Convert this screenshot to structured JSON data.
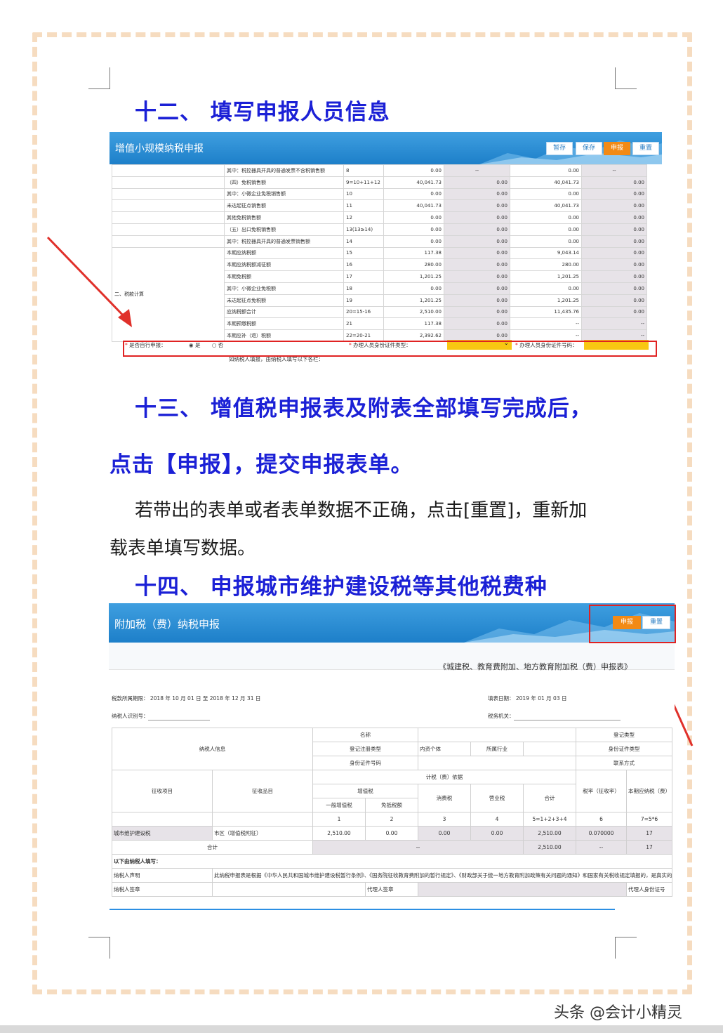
{
  "section12": {
    "heading": "十二、 填写申报人员信息"
  },
  "shot1": {
    "title": "增值小规模纳税申报",
    "buttons": [
      "暂存",
      "保存",
      "申报",
      "重置"
    ],
    "rows": [
      [
        "其中：税控器具开具的普通发票不含税销售额",
        "8",
        "0.00",
        "--",
        "0.00",
        "--"
      ],
      [
        "（四）免税销售额",
        "9=10+11+12",
        "40,041.73",
        "0.00",
        "40,041.73",
        "0.00"
      ],
      [
        "其中：小微企业免税销售额",
        "10",
        "0.00",
        "0.00",
        "0.00",
        "0.00"
      ],
      [
        "未达起征点销售额",
        "11",
        "40,041.73",
        "0.00",
        "40,041.73",
        "0.00"
      ],
      [
        "其他免税销售额",
        "12",
        "0.00",
        "0.00",
        "0.00",
        "0.00"
      ],
      [
        "（五）出口免税销售额",
        "13(13≥14)",
        "0.00",
        "0.00",
        "0.00",
        "0.00"
      ],
      [
        "其中：税控器具开具的普通发票销售额",
        "14",
        "0.00",
        "0.00",
        "0.00",
        "0.00"
      ],
      [
        "本期应纳税额",
        "15",
        "117.38",
        "0.00",
        "9,043.14",
        "0.00"
      ],
      [
        "本期应纳税额减征额",
        "16",
        "280.00",
        "0.00",
        "280.00",
        "0.00"
      ],
      [
        "本期免税额",
        "17",
        "1,201.25",
        "0.00",
        "1,201.25",
        "0.00"
      ],
      [
        "其中：小微企业免税额",
        "18",
        "0.00",
        "0.00",
        "0.00",
        "0.00"
      ],
      [
        "未达起征点免税额",
        "19",
        "1,201.25",
        "0.00",
        "1,201.25",
        "0.00"
      ],
      [
        "应纳税额合计",
        "20=15-16",
        "2,510.00",
        "0.00",
        "11,435.76",
        "0.00"
      ],
      [
        "本期预缴税额",
        "21",
        "117.38",
        "0.00",
        "--",
        "--"
      ],
      [
        "本期应补（退）税额",
        "22=20-21",
        "2,392.62",
        "0.00",
        "--",
        "--"
      ]
    ],
    "section_label": "二、税款计算",
    "self_filing_label": "是否自行申报：",
    "yes": "是",
    "no": "否",
    "id_type_label": "办理人员身份证件类型：",
    "id_number_label": "办理人员身份证件号码：",
    "note": "如纳税人填报，由纳税人填写以下各栏："
  },
  "section13": {
    "heading_line1": "十三、 增值税申报表及附表全部填写完成后，",
    "heading_line2": "点击【申报】，提交申报表单。",
    "para_line1": "若带出的表单或者表单数据不正确，点击[重置]，重新加",
    "para_line2": "载表单填写数据。"
  },
  "section14": {
    "heading": "十四、 申报城市维护建设税等其他税费种"
  },
  "shot2": {
    "title": "附加税（费）纳税申报",
    "buttons": [
      "申报",
      "重置"
    ],
    "form_title": "《城建税、教育费附加、地方教育附加税（费）申报表》",
    "period_label": "税款所属期限：",
    "period": "2018 年   10 月  01 日 至 2018 年   12 月  31 日",
    "fill_date_label": "填表日期：",
    "fill_date": "2019 年   01 月  03 日",
    "taxpayer_id_label": "纳税人识别号：",
    "tax_office_label": "税务机关：",
    "info_label": "纳税人信息",
    "name_label": "名称",
    "reg_type_label": "登记注册类型",
    "reg_type_value": "内资个体",
    "industry_label": "所属行业",
    "id_no_label": "身份证件号码",
    "reg_kind_label": "登记类型",
    "id_kind_label": "身份证件类型",
    "contact_label": "联系方式",
    "col_item": "征收项目",
    "col_subitem": "征收品目",
    "col_basis": "计税（费）依据",
    "col_vat": "增值税",
    "col_general_vat": "一般增值税",
    "col_exempt": "免抵税额",
    "col_consumption": "消费税",
    "col_business": "营业税",
    "col_total": "合计",
    "col_rate": "税率（征收率）",
    "col_due": "本期应纳税（费）",
    "col_nums": [
      "1",
      "2",
      "3",
      "4",
      "5=1+2+3+4",
      "6",
      "7=5*6"
    ],
    "row_item": "城市维护建设税",
    "row_subitem": "市区（增值税附征）",
    "row_values": [
      "2,510.00",
      "0.00",
      "0.00",
      "0.00",
      "2,510.00",
      "0.070000",
      "17"
    ],
    "sum_label": "合计",
    "sum_dash": "--",
    "sum_total": "2,510.00",
    "sum_rate": "--",
    "sum_due": "17",
    "below_label": "以下由纳税人填写：",
    "statement_label": "纳税人声明",
    "statement_text": "此纳税申报表是根据《中华人民共和国城市维护建设税暂行条例》、《国务院征收教育费附加的暂行规定》、《财政部关于统一地方教育附加政策有关问题的通知》和国家有关税收规定填报的，是真实的、可靠的",
    "sign_label": "纳税人签章",
    "agent_sign_label": "代理人签章",
    "agent_id_label": "代理人身份证号"
  },
  "credit": "头条 @会计小精灵"
}
